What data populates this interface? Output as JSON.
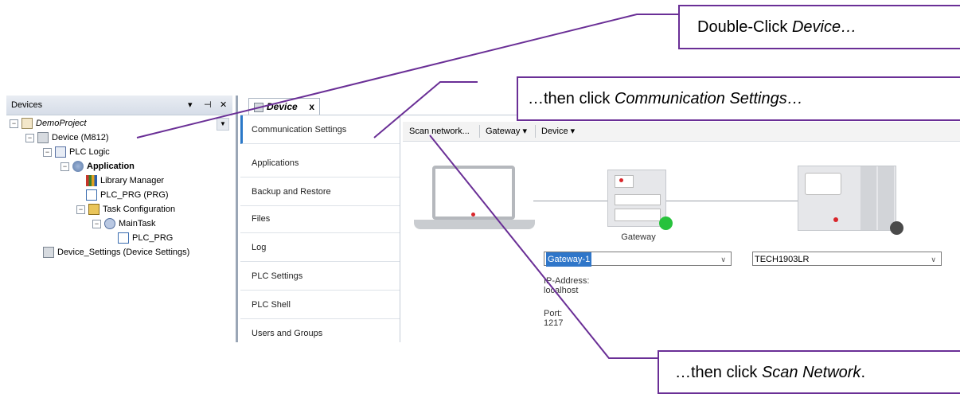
{
  "devices_panel": {
    "title": "Devices",
    "controls": {
      "dropdown": "▾",
      "pin": "⊣",
      "close": "✕"
    },
    "tree": [
      {
        "label": "DemoProject",
        "icon": "project-icon"
      },
      {
        "label": "Device (M812)",
        "icon": "device-icon"
      },
      {
        "label": "PLC Logic",
        "icon": "plc-logic-icon"
      },
      {
        "label": "Application",
        "icon": "application-icon"
      },
      {
        "label": "Library Manager",
        "icon": "library-manager-icon"
      },
      {
        "label": "PLC_PRG (PRG)",
        "icon": "program-icon"
      },
      {
        "label": "Task Configuration",
        "icon": "task-configuration-icon"
      },
      {
        "label": "MainTask",
        "icon": "main-task-icon"
      },
      {
        "label": "PLC_PRG",
        "icon": "program-call-icon"
      },
      {
        "label": "Device_Settings (Device Settings)",
        "icon": "device-icon"
      }
    ]
  },
  "editor": {
    "tab_label": "Device",
    "tab_close": "x",
    "nav": [
      "Communication Settings",
      "Applications",
      "Backup and Restore",
      "Files",
      "Log",
      "PLC Settings",
      "PLC Shell",
      "Users and Groups"
    ],
    "active_nav": "Communication Settings",
    "toolbar": {
      "scan": "Scan network...",
      "gateway": "Gateway ▾",
      "device": "Device ▾"
    },
    "gateway_label": "Gateway",
    "gateway_select": "Gateway-1",
    "device_select": "TECH1903LR",
    "ip_label": "IP-Address:",
    "ip_value": "localhost",
    "port_label": "Port:",
    "port_value": "1217",
    "colors": {
      "gateway_status": "#27c23c",
      "device_status": "#4a4a4a",
      "accent": "#2a78c8"
    }
  },
  "callouts": {
    "c1_text": "Double-Click ",
    "c1_em": "Device…",
    "c2_text": "…then click ",
    "c2_em": "Communication Settings…",
    "c3_text": "…then click ",
    "c3_em": "Scan Network",
    "c3_end": ".",
    "color": "#6a2f96"
  }
}
